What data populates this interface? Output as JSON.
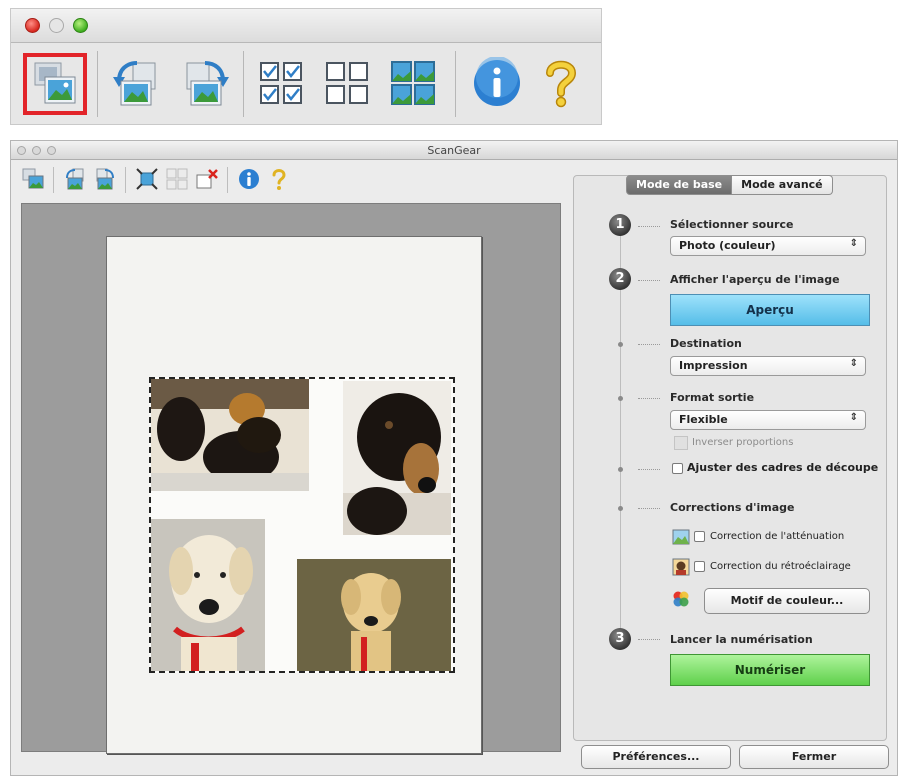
{
  "top_toolbar": {
    "icons": [
      "scan-document-icon",
      "rotate-left-icon",
      "rotate-right-icon",
      "auto-crop-icon",
      "crop-frames-icon",
      "multi-crop-icon",
      "info-icon",
      "help-icon"
    ],
    "highlight_color": "#e2242a"
  },
  "window": {
    "title": "ScanGear"
  },
  "tabs": {
    "basic": "Mode de base",
    "advanced": "Mode avancé"
  },
  "steps": {
    "step1": {
      "number": "1",
      "label": "Sélectionner source",
      "value": "Photo (couleur)"
    },
    "step2": {
      "number": "2",
      "label": "Afficher l'aperçu de l'image",
      "button": "Aperçu"
    },
    "destination": {
      "label": "Destination",
      "value": "Impression"
    },
    "output": {
      "label": "Format sortie",
      "value": "Flexible",
      "invert": "Inverser proportions"
    },
    "adjust": {
      "label": "Ajuster des cadres de découpe"
    },
    "corrections": {
      "label": "Corrections d'image",
      "fade": "Correction de l'atténuation",
      "backlight": "Correction du rétroéclairage",
      "color_pattern": "Motif de couleur..."
    },
    "step3": {
      "number": "3",
      "label": "Lancer la numérisation",
      "button": "Numériser"
    }
  },
  "footer": {
    "preferences": "Préférences...",
    "close": "Fermer"
  },
  "colors": {
    "preview_blue": "#55bde8",
    "scan_green": "#5fd04b"
  }
}
